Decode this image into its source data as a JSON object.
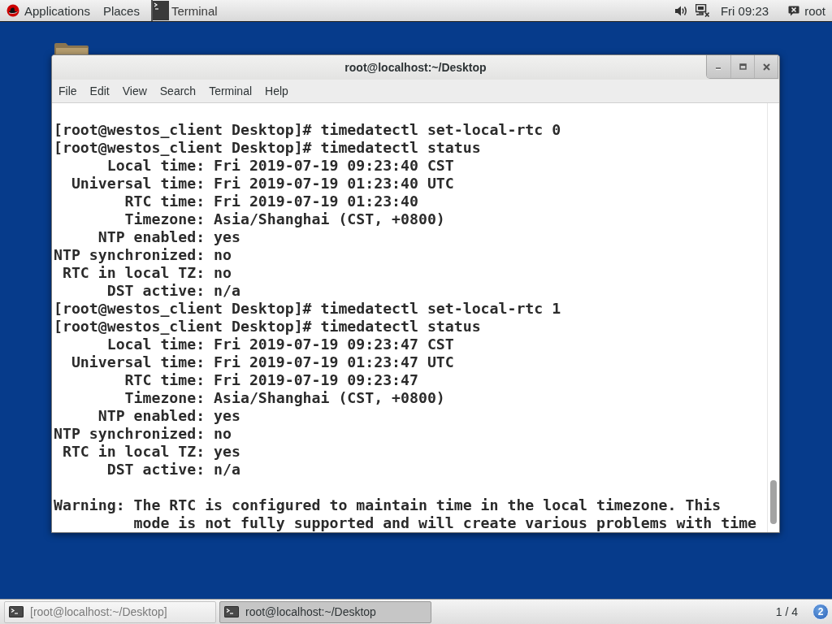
{
  "top_bar": {
    "menus": [
      "Applications",
      "Places"
    ],
    "active_app": "Terminal",
    "clock": "Fri 09:23",
    "user": "root"
  },
  "window": {
    "title": "root@localhost:~/Desktop",
    "menu": [
      "File",
      "Edit",
      "View",
      "Search",
      "Terminal",
      "Help"
    ],
    "terminal": {
      "lines": [
        "[root@westos_client Desktop]# timedatectl set-local-rtc 0",
        "[root@westos_client Desktop]# timedatectl status",
        "      Local time: Fri 2019-07-19 09:23:40 CST",
        "  Universal time: Fri 2019-07-19 01:23:40 UTC",
        "        RTC time: Fri 2019-07-19 01:23:40",
        "        Timezone: Asia/Shanghai (CST, +0800)",
        "     NTP enabled: yes",
        "NTP synchronized: no",
        " RTC in local TZ: no",
        "      DST active: n/a",
        "[root@westos_client Desktop]# timedatectl set-local-rtc 1",
        "[root@westos_client Desktop]# timedatectl status",
        "      Local time: Fri 2019-07-19 09:23:47 CST",
        "  Universal time: Fri 2019-07-19 01:23:47 UTC",
        "        RTC time: Fri 2019-07-19 09:23:47",
        "        Timezone: Asia/Shanghai (CST, +0800)",
        "     NTP enabled: yes",
        "NTP synchronized: no",
        " RTC in local TZ: yes",
        "      DST active: n/a"
      ],
      "warning": [
        "Warning: The RTC is configured to maintain time in the local timezone. This",
        "         mode is not fully supported and will create various problems with time"
      ]
    }
  },
  "taskbar": {
    "items": [
      {
        "label": "[root@localhost:~/Desktop]",
        "selected": false
      },
      {
        "label": "root@localhost:~/Desktop",
        "selected": true
      }
    ],
    "workspace": "1 / 4",
    "notifications": "2"
  }
}
